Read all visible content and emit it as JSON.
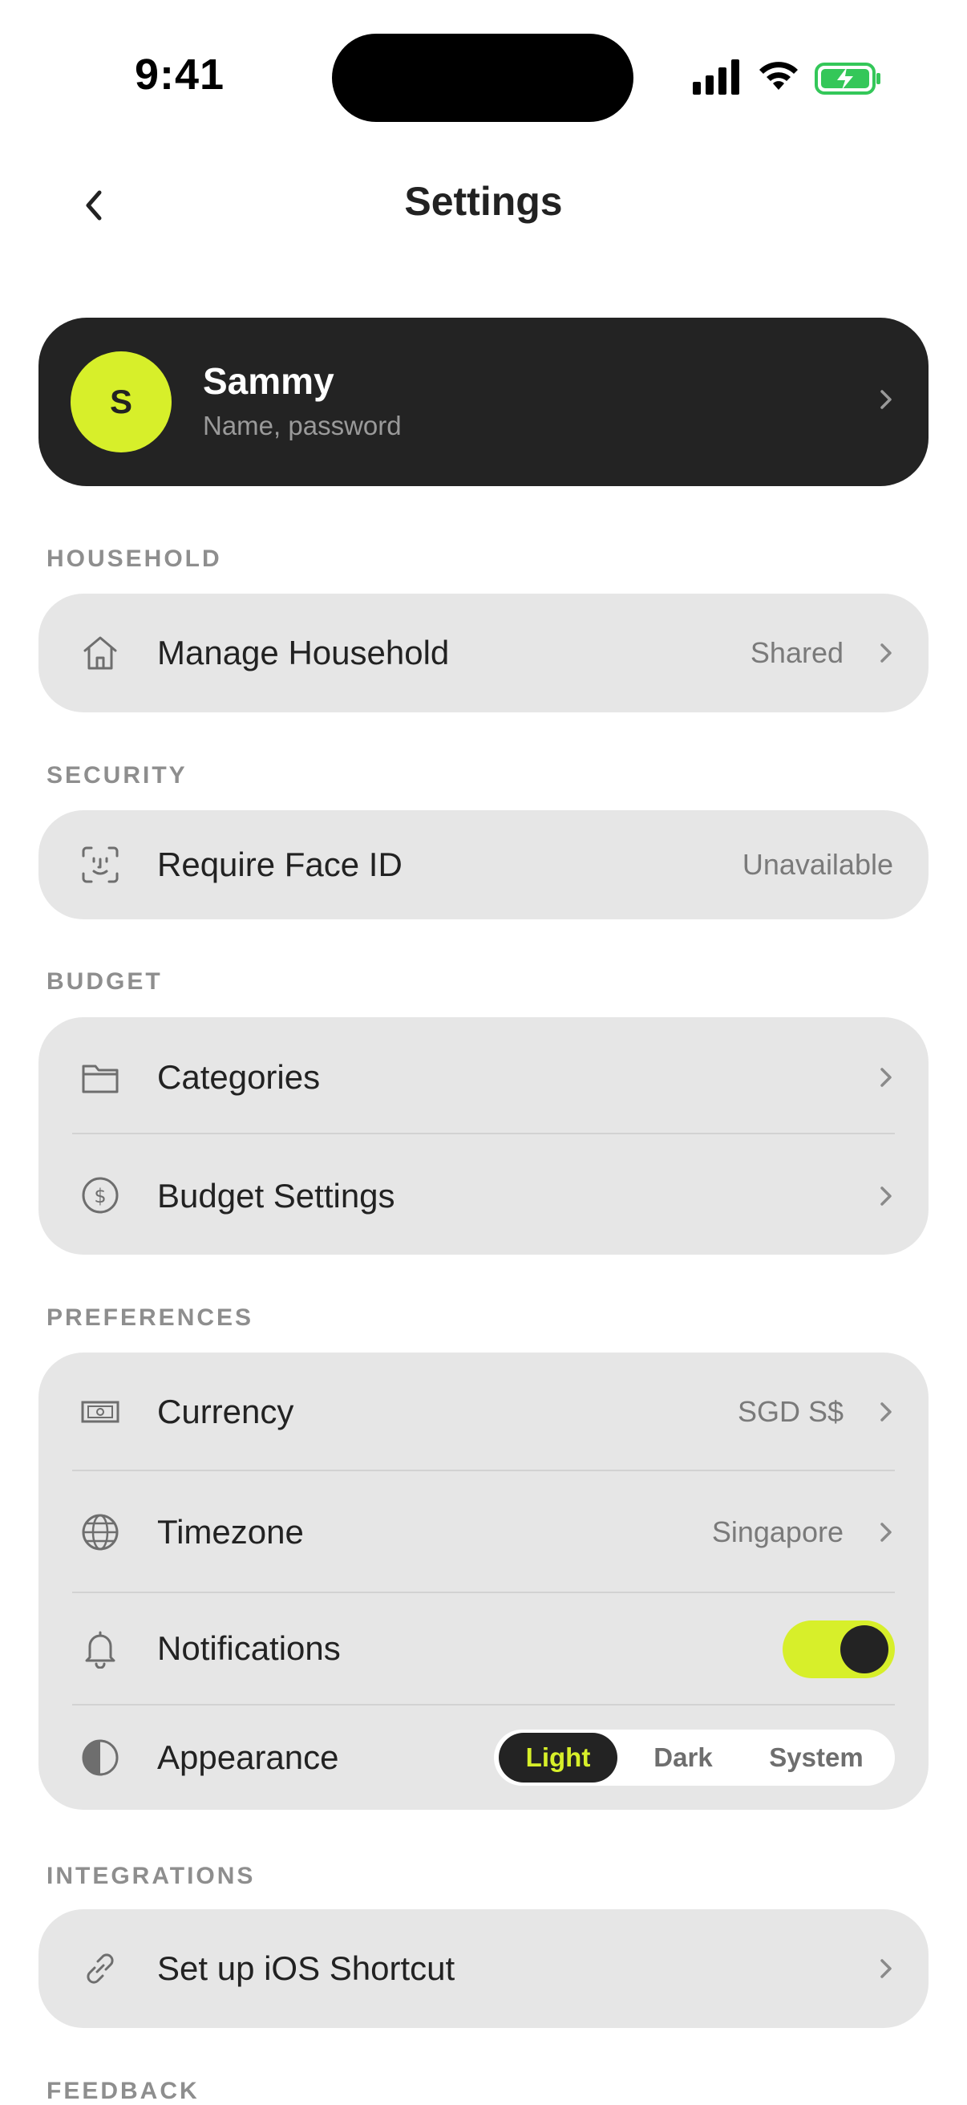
{
  "status_bar": {
    "time": "9:41"
  },
  "nav": {
    "title": "Settings"
  },
  "profile": {
    "initial": "S",
    "name": "Sammy",
    "subtitle": "Name, password"
  },
  "sections": {
    "household": {
      "header": "HOUSEHOLD",
      "rows": [
        {
          "icon": "house-icon",
          "label": "Manage Household",
          "value": "Shared"
        }
      ]
    },
    "security": {
      "header": "SECURITY",
      "rows": [
        {
          "icon": "face-id-icon",
          "label": "Require Face ID",
          "value": "Unavailable"
        }
      ]
    },
    "budget": {
      "header": "BUDGET",
      "rows": [
        {
          "icon": "folder-icon",
          "label": "Categories"
        },
        {
          "icon": "dollar-circle-icon",
          "label": "Budget Settings"
        }
      ]
    },
    "preferences": {
      "header": "PREFERENCES",
      "rows": [
        {
          "icon": "banknote-icon",
          "label": "Currency",
          "value": "SGD S$"
        },
        {
          "icon": "globe-icon",
          "label": "Timezone",
          "value": "Singapore"
        },
        {
          "icon": "bell-icon",
          "label": "Notifications",
          "toggle_on": true
        },
        {
          "icon": "half-circle-icon",
          "label": "Appearance",
          "options": [
            "Light",
            "Dark",
            "System"
          ],
          "selected": "Light"
        }
      ]
    },
    "integrations": {
      "header": "INTEGRATIONS",
      "rows": [
        {
          "icon": "link-icon",
          "label": "Set up iOS Shortcut"
        }
      ]
    },
    "feedback": {
      "header": "FEEDBACK"
    }
  },
  "colors": {
    "accent": "#d7ef2a",
    "dark": "#232323",
    "card": "#e6e6e6",
    "muted": "#8e8e8e"
  }
}
